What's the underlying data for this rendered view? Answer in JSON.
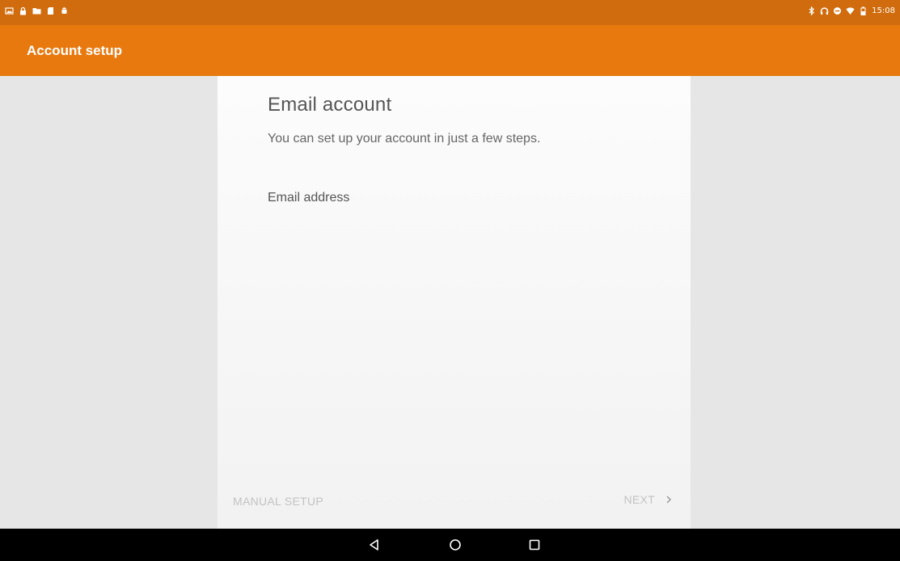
{
  "status_bar": {
    "left_icons": [
      "picture-icon",
      "lock-icon",
      "folder-icon",
      "sd-card-icon",
      "android-icon"
    ],
    "right_icons": [
      "bluetooth-icon",
      "headset-icon",
      "do-not-disturb-icon",
      "wifi-icon",
      "battery-icon"
    ],
    "time": "15:08"
  },
  "app_bar": {
    "title": "Account setup",
    "color": "#e8790f",
    "status_color": "#d06c0d"
  },
  "card": {
    "title": "Email account",
    "subtitle": "You can set up your account in just a few steps.",
    "email_field": {
      "placeholder": "Email address",
      "value": ""
    }
  },
  "actions": {
    "manual_setup": "MANUAL SETUP",
    "next": "NEXT"
  },
  "nav_bar": {
    "icons": [
      "back-icon",
      "home-icon",
      "recents-icon"
    ]
  }
}
